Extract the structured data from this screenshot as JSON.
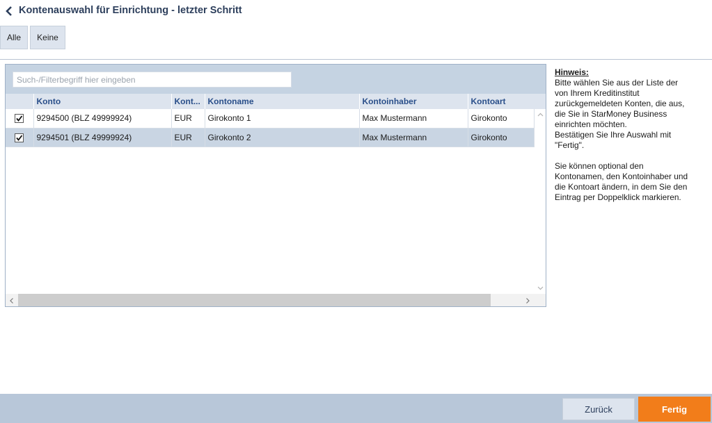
{
  "header": {
    "title": "Kontenauswahl für Einrichtung - letzter Schritt",
    "back_icon": "chevron-left-icon"
  },
  "selection": {
    "all_label": "Alle",
    "none_label": "Keine"
  },
  "search": {
    "placeholder": "Such-/Filterbegriff hier eingeben",
    "value": ""
  },
  "table": {
    "columns": [
      "Konto",
      "Kont...",
      "Kontoname",
      "Kontoinhaber",
      "Kontoart"
    ],
    "rows": [
      {
        "checked": true,
        "konto": "9294500 (BLZ 49999924)",
        "waehrung": "EUR",
        "kontoname": "Girokonto 1",
        "inhaber": "Max Mustermann",
        "art": "Girokonto"
      },
      {
        "checked": true,
        "konto": "9294501 (BLZ 49999924)",
        "waehrung": "EUR",
        "kontoname": "Girokonto 2",
        "inhaber": "Max Mustermann",
        "art": "Girokonto"
      }
    ]
  },
  "hint": {
    "title": "Hinweis:",
    "line1": "Bitte wählen Sie aus der Liste der",
    "line2": "von Ihrem Kreditinstitut",
    "line3": "zurückgemeldeten Konten, die aus,",
    "line4": "die Sie in StarMoney Business",
    "line5": "einrichten möchten.",
    "line6": "Bestätigen Sie Ihre Auswahl mit",
    "line7": "\"Fertig\".",
    "line8": "Sie können optional den",
    "line9": "Kontonamen, den Kontoinhaber und",
    "line10": "die Kontoart ändern, in dem Sie den",
    "line11": "Eintrag per Doppelklick markieren."
  },
  "footer": {
    "back_label": "Zurück",
    "finish_label": "Fertig"
  },
  "colors": {
    "accent": "#f27d1a",
    "title": "#2d3f5c",
    "header_text": "#2a4f8a",
    "selected_row": "#c9d5e3"
  }
}
